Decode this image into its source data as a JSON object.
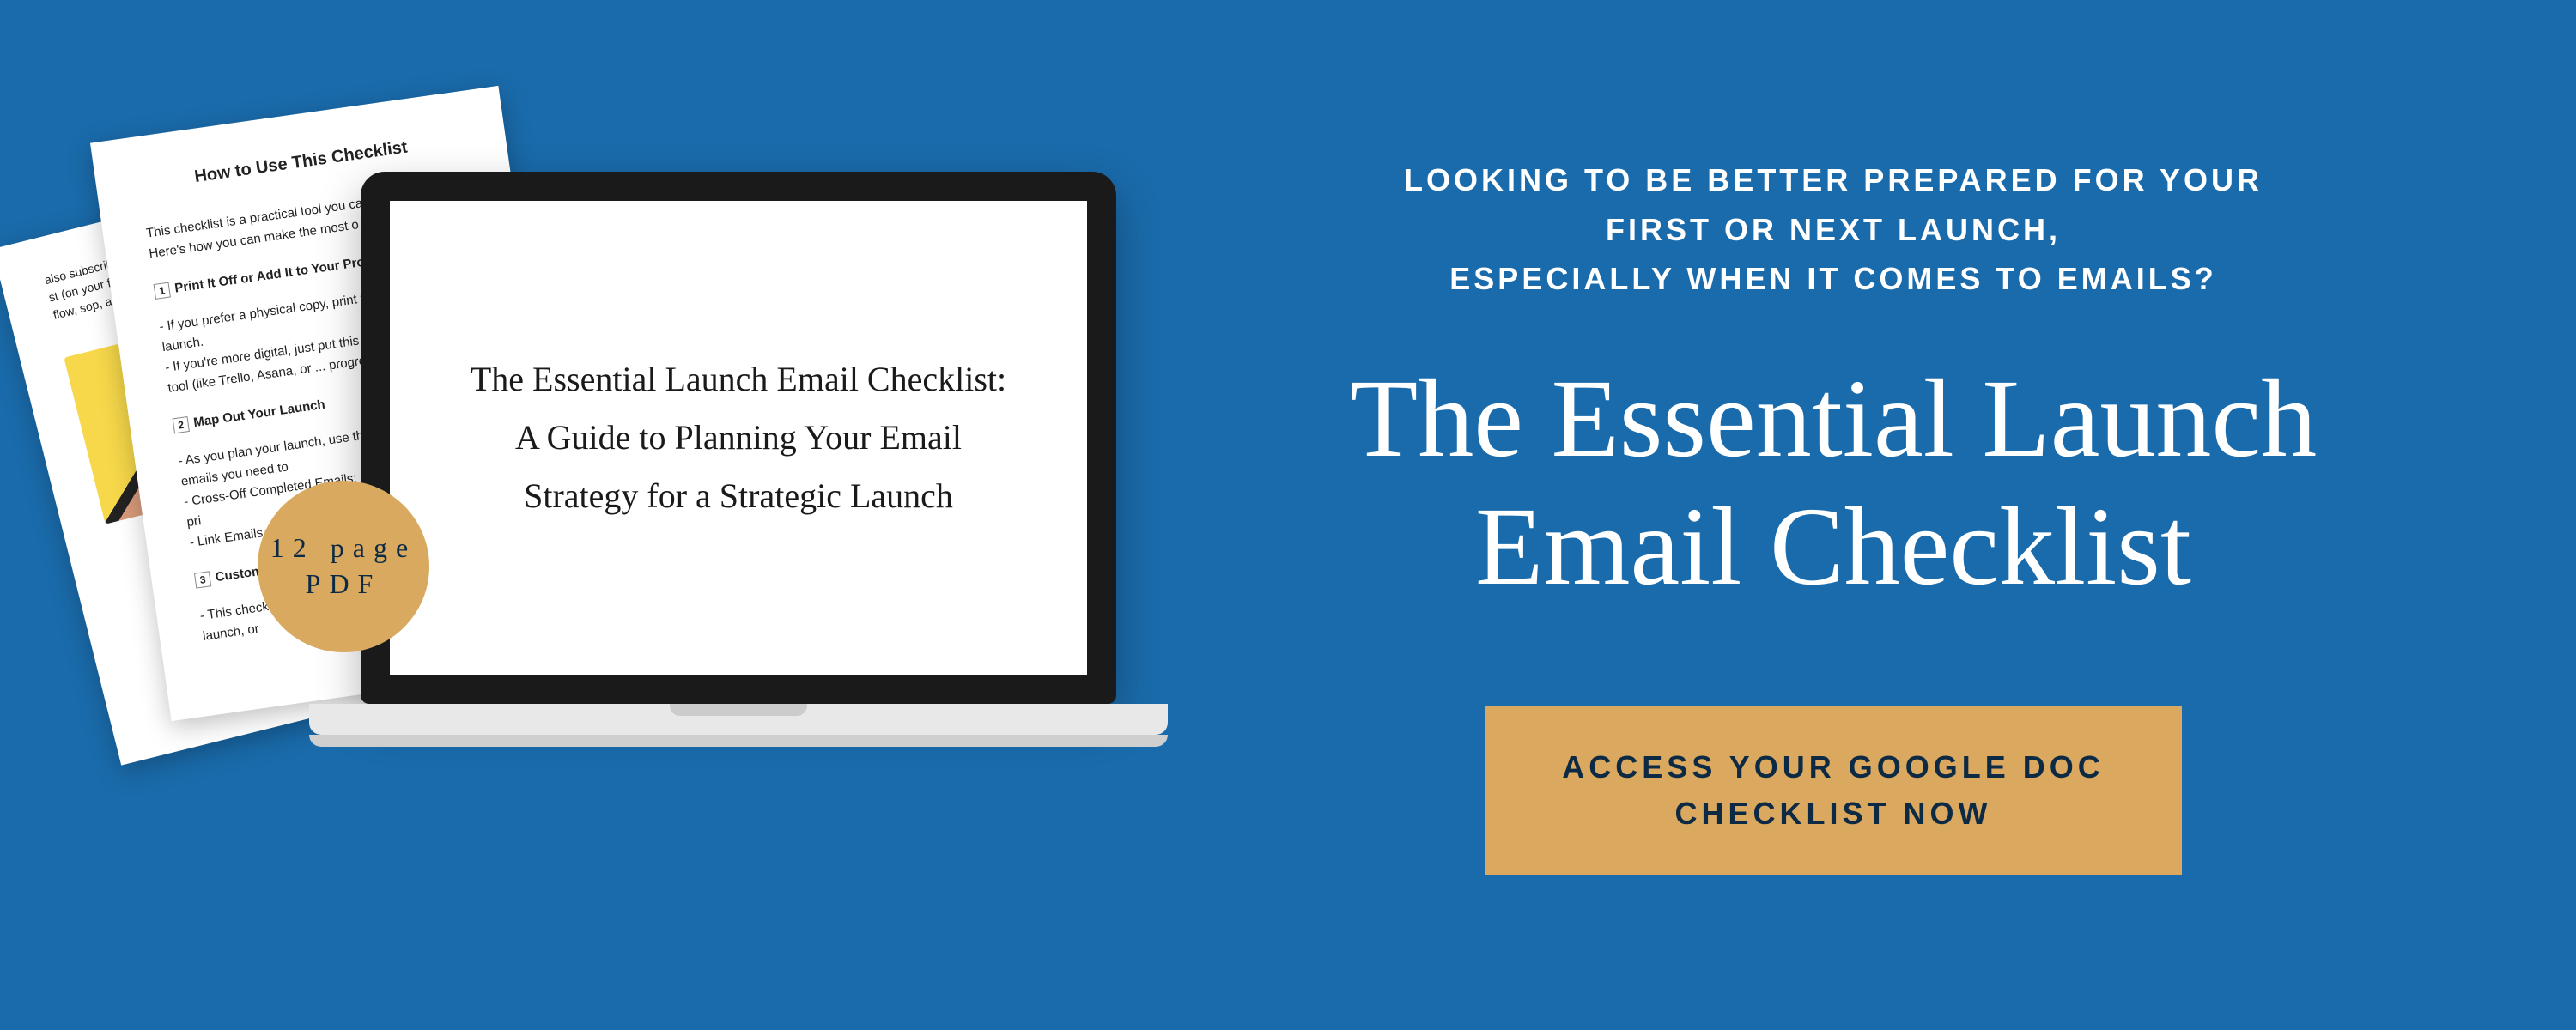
{
  "badge": {
    "line1": "12 page",
    "line2": "PDF"
  },
  "paper_back": {
    "snippet1": "also subscribe",
    "snippet2": "st (on your favor",
    "snippet3": "flow, sop, and lau"
  },
  "paper_front": {
    "heading": "How to Use This Checklist",
    "intro": "This checklist is a practical tool you can custo... needs. Here's how you can make the most o",
    "item1_title": "Print It Off or Add It to Your Project Manag",
    "item1_body": "- If you prefer a physical copy, print the ch you plan your launch.\n- If you're more digital, just put this chec management tool (like Trello, Asana, or ... progress.",
    "item2_title": "Map Out Your Launch",
    "item2_body": "- As you plan your launch, use this different types of emails you need to\n- Cross-Off Completed Emails: Or email, cross it off your pri\n- Link Emails: If you emails you've writt reference.",
    "item3_title": "Customize to Fit",
    "item3_body": "- This checklist cov is not one-size-fits-al your specific launch, or"
  },
  "laptop": {
    "screen_text": "The Essential Launch Email Checklist:\nA Guide to Planning Your Email\nStrategy for a Strategic Launch"
  },
  "right": {
    "eyebrow_line1": "LOOKING TO BE BETTER PREPARED FOR YOUR",
    "eyebrow_line2": "FIRST OR NEXT LAUNCH,",
    "eyebrow_line3": "ESPECIALLY WHEN IT COMES TO EMAILS?",
    "headline_line1": "The Essential Launch",
    "headline_line2": "Email Checklist",
    "cta_line1": "ACCESS YOUR GOOGLE DOC",
    "cta_line2": "CHECKLIST NOW"
  },
  "colors": {
    "background": "#1a6bab",
    "accent": "#dba860",
    "dark_navy": "#0d2a44"
  }
}
